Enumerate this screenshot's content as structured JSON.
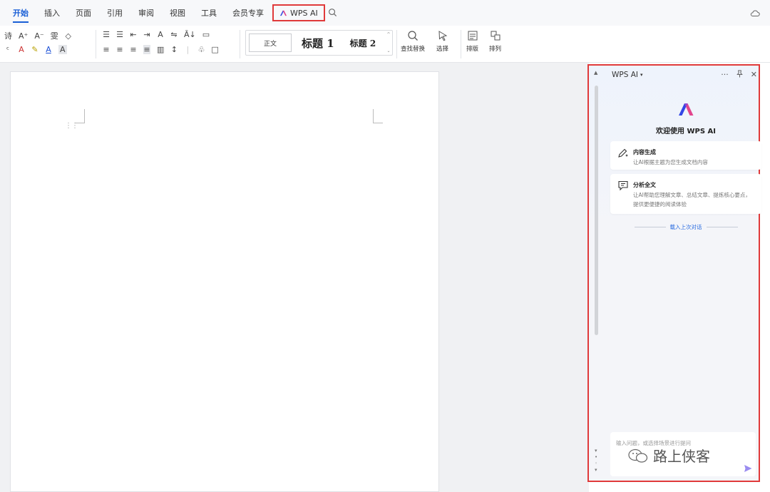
{
  "menubar": {
    "tabs": [
      "开始",
      "插入",
      "页面",
      "引用",
      "审阅",
      "视图",
      "工具",
      "会员专享"
    ],
    "wps_ai_tab": "WPS AI"
  },
  "ribbon": {
    "font_row1": [
      "诗",
      "A⁺",
      "A⁻",
      "雯",
      "◇"
    ],
    "font_row2": [
      "ᶜ",
      "A",
      "✎",
      "A",
      "A"
    ],
    "para_row1": [
      "☰",
      "☰",
      "⇤",
      "⇥",
      "A",
      "⇋",
      "Ā↓",
      "▭"
    ],
    "para_row2": [
      "≡",
      "≡",
      "≡",
      "≡",
      "▥",
      "↕",
      "|",
      "♧",
      "□"
    ],
    "styles": {
      "normal": "正文",
      "heading1": "标题 1",
      "heading2": "标题 2"
    },
    "find_replace": "查找替换",
    "select": "选择",
    "layout": "排版",
    "arrange": "排列"
  },
  "panel": {
    "title": "WPS AI",
    "actions": {
      "more": "···"
    },
    "welcome": "欢迎使用 WPS AI",
    "cards": [
      {
        "title": "内容生成",
        "desc": "让AI根据主题为您生成文档内容"
      },
      {
        "title": "分析全文",
        "desc": "让AI帮助您理解文章、总结文章、提炼核心要点，提供更便捷的阅读体验"
      }
    ],
    "history_link": "载入上次对话",
    "input_placeholder": "输入问题，或选择场景进行提问"
  },
  "watermark": {
    "text": "路上侠客"
  },
  "colors": {
    "accent": "#1a5fd6",
    "highlight_border": "#e03a3a",
    "link": "#2a6ce0"
  }
}
